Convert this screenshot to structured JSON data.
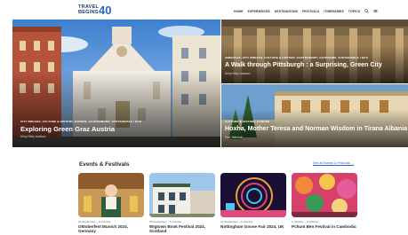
{
  "logo": {
    "line1": "TRAVEL",
    "line2": "BEGINS",
    "number": "40"
  },
  "nav": {
    "items": [
      "HOME",
      "EXPERIENCES",
      "DESTINATIONS",
      "FESTIVALS",
      "ITINERARIES",
      "TOPICS"
    ],
    "icons": [
      "search-icon",
      "menu-icon"
    ]
  },
  "hero": {
    "main": {
      "tags": "CITY BREAKS, CULTURE & HISTORY, EUROPE, GASTRONOMY, SUSTAINABLE / ECO",
      "title": "Exploring Green Graz Austria",
      "author": "Kerry Kirby Jackson"
    },
    "top_right": {
      "tags": "AMERICAS, CITY BREAKS, CULTURE & HISTORY, GASTRONOMY, OUTDOORS, SUSTAINABLE / ECO",
      "title": "A Walk through Pittsburgh : a Surprising, Green City",
      "author": "Kerry Kirby Jackson"
    },
    "bottom_right": {
      "tags": "CULTURE & HISTORY, EUROPE",
      "title": "Hoxha, Mother Teresa and Norman Wisdom in Tirana Albania",
      "author": "Paul Tattersall"
    }
  },
  "events": {
    "heading": "Events & Festivals",
    "link": "See all Events & Festivals →",
    "cards": [
      {
        "date": "21 September – 6 October",
        "title": "Oktoberfest Munich 2024, Germany"
      },
      {
        "date": "25 September – 6 October",
        "title": "Wigtown Book Festival 2024, Scotland"
      },
      {
        "date": "27 September – 6 October",
        "title": "Nottingham Goose Fair 2024, UK"
      },
      {
        "date": "1 October – 4 October",
        "title": "Pchum Ben Festival in Cambodia"
      }
    ]
  }
}
